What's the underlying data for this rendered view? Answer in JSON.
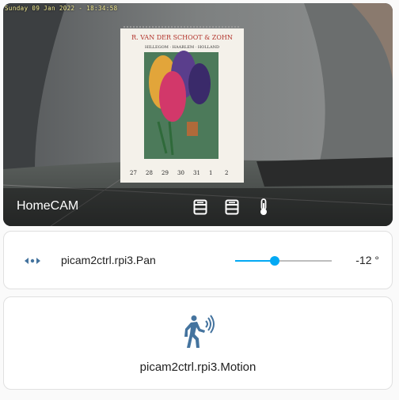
{
  "camera": {
    "title": "HomeCAM",
    "timestamp": "Sunday 09 Jan 2022 - 18:34:58",
    "calendar": {
      "header": "R. VAN DER SCHOOT & ZOHN",
      "subheader": "HILLEGOM · HAARLEM · HOLLAND",
      "dates": [
        "27",
        "28",
        "29",
        "30",
        "31",
        "1",
        "2"
      ]
    },
    "buttons": [
      {
        "icon": "server-icon"
      },
      {
        "icon": "server-icon"
      },
      {
        "icon": "thermometer-icon"
      }
    ]
  },
  "pan": {
    "name": "picam2ctrl.rpi3.Pan",
    "value_label": "-12 °",
    "level": 0.41,
    "accent": "#03a9f4"
  },
  "motion": {
    "name": "picam2ctrl.rpi3.Motion",
    "icon_color": "#44739e"
  }
}
